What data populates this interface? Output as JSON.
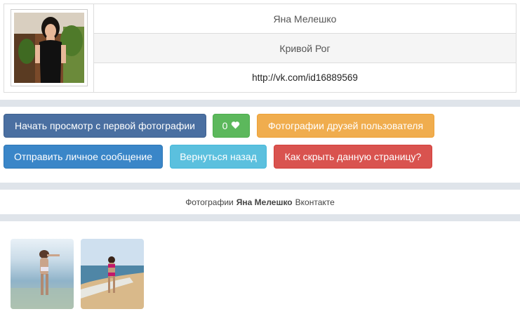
{
  "profile": {
    "name": "Яна Мелешко",
    "city": "Кривой Рог",
    "url": "http://vk.com/id16889569"
  },
  "buttons": {
    "start_view": "Начать просмотр с первой фотографии",
    "likes_count": "0",
    "friends_photos": "Фотографии друзей пользователя",
    "send_message": "Отправить личное сообщение",
    "go_back": "Вернуться назад",
    "hide_page": "Как скрыть данную страницу?"
  },
  "caption": {
    "prefix": "Фотографии",
    "name": "Яна Мелешко",
    "suffix": "Вконтакте"
  },
  "photos": [
    {
      "icon": "beach-photo-1"
    },
    {
      "icon": "beach-photo-2"
    }
  ],
  "colors": {
    "primary": "#4a6fa1",
    "success": "#5cb85c",
    "warning": "#f0ad4e",
    "blue": "#3a86c8",
    "info": "#5bc0de",
    "danger": "#d9534f",
    "band": "#dfe4ea"
  }
}
